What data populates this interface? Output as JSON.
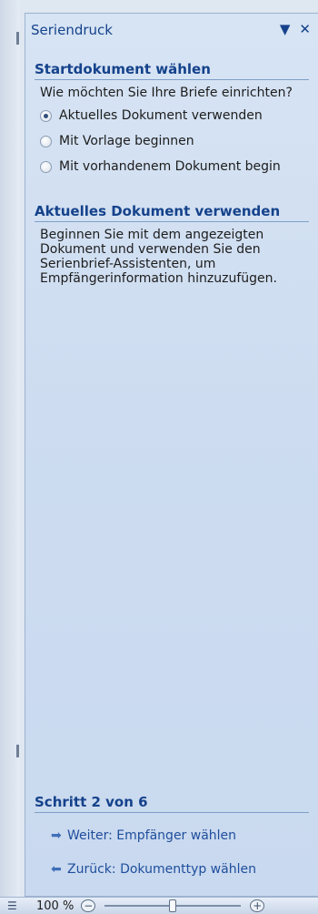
{
  "pane": {
    "title": "Seriendruck",
    "dropdown_icon": "▼",
    "close_icon": "✕"
  },
  "section1": {
    "heading": "Startdokument wählen",
    "question": "Wie möchten Sie Ihre Briefe einrichten?",
    "options": [
      {
        "label": "Aktuelles Dokument verwenden",
        "selected": true
      },
      {
        "label": "Mit Vorlage beginnen",
        "selected": false
      },
      {
        "label": "Mit vorhandenem Dokument begin",
        "selected": false
      }
    ]
  },
  "section2": {
    "heading": "Aktuelles Dokument verwenden",
    "description": "Beginnen Sie mit dem angezeigten Dokument und verwenden Sie den Serienbrief-Assistenten, um Empfängerinformation hinzuzufügen."
  },
  "step": {
    "label": "Schritt 2 von 6",
    "next": "Weiter: Empfänger wählen",
    "back": "Zurück: Dokumenttyp wählen",
    "next_icon": "arrow-right-icon",
    "back_icon": "arrow-left-icon"
  },
  "statusbar": {
    "view_icon": "layout-icon",
    "zoom": "100 %",
    "minus": "−",
    "plus": "+",
    "zoom_level": 0.5
  }
}
